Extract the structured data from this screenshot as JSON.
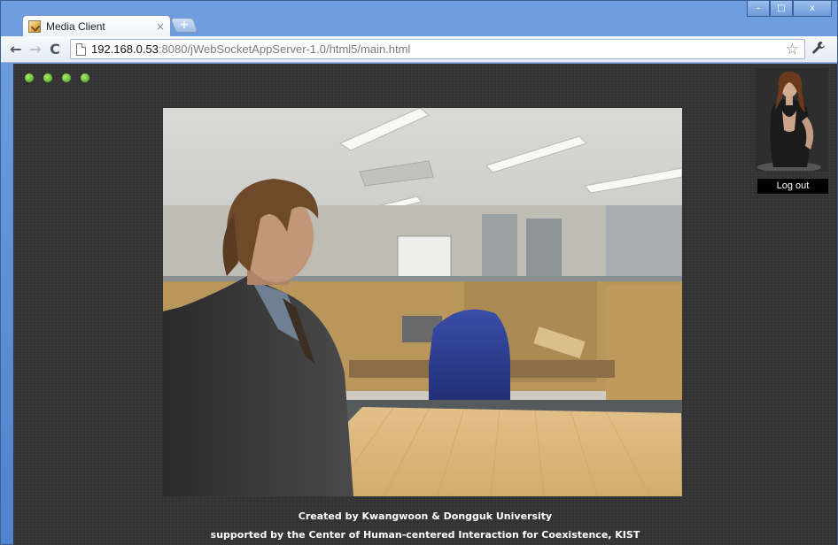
{
  "tab": {
    "title": "Media Client",
    "close_symbol": "×",
    "favicon": "media-client-favicon-icon"
  },
  "new_tab": {
    "symbol": "+"
  },
  "window_controls": {
    "minimize": "–",
    "maximize": "□",
    "close": "x"
  },
  "toolbar": {
    "back": "←",
    "forward": "→",
    "reload": "C",
    "url_host": "192.168.0.53",
    "url_rest": ":8080/jWebSocketAppServer-1.0/html5/main.html",
    "bookmark_star": "☆",
    "wrench": "🔧"
  },
  "status_dots": {
    "count": 4,
    "color": "#6cc13a"
  },
  "video": {
    "description_icon": "video-stream"
  },
  "user_panel": {
    "logout_label": "Log out"
  },
  "footer": {
    "line1": "Created by Kwangwoon & Dongguk University",
    "line2": "supported by the Center of Human-centered Interaction for Coexistence, KIST"
  }
}
